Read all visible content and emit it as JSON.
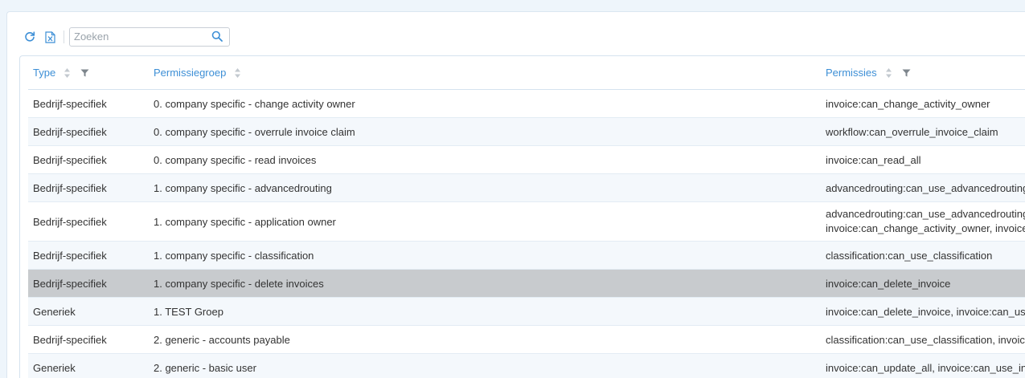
{
  "toolbar": {
    "refresh_icon": "refresh-icon",
    "excel_icon": "excel-export-icon",
    "search_placeholder": "Zoeken",
    "search_value": ""
  },
  "table": {
    "columns": [
      {
        "label": "Type",
        "sortable": true,
        "filterable": true
      },
      {
        "label": "Permissiegroep",
        "sortable": true,
        "filterable": false
      },
      {
        "label": "Permissies",
        "sortable": true,
        "filterable": true
      }
    ],
    "rows": [
      {
        "type": "Bedrijf-specifiek",
        "group": "0. company specific - change activity owner",
        "permissions": [
          "invoice:can_change_activity_owner"
        ]
      },
      {
        "type": "Bedrijf-specifiek",
        "group": "0. company specific - overrule invoice claim",
        "permissions": [
          "workflow:can_overrule_invoice_claim"
        ]
      },
      {
        "type": "Bedrijf-specifiek",
        "group": "0. company specific - read invoices",
        "permissions": [
          "invoice:can_read_all"
        ]
      },
      {
        "type": "Bedrijf-specifiek",
        "group": "1. company specific - advancedrouting",
        "permissions": [
          "advancedrouting:can_use_advancedrouting"
        ]
      },
      {
        "type": "Bedrijf-specifiek",
        "group": "1. company specific - application owner",
        "permissions": [
          "advancedrouting:can_use_advancedrouting,",
          "invoice:can_change_activity_owner, invoice:c"
        ]
      },
      {
        "type": "Bedrijf-specifiek",
        "group": "1. company specific - classification",
        "permissions": [
          "classification:can_use_classification"
        ]
      },
      {
        "type": "Bedrijf-specifiek",
        "group": "1. company specific - delete invoices",
        "permissions": [
          "invoice:can_delete_invoice"
        ],
        "selected": true
      },
      {
        "type": "Generiek",
        "group": "1. TEST Groep",
        "permissions": [
          "invoice:can_delete_invoice, invoice:can_use_"
        ]
      },
      {
        "type": "Bedrijf-specifiek",
        "group": "2. generic - accounts payable",
        "permissions": [
          "classification:can_use_classification, invoice"
        ]
      },
      {
        "type": "Generiek",
        "group": "2. generic - basic user",
        "permissions": [
          "invoice:can_update_all, invoice:can_use_invo"
        ]
      }
    ]
  },
  "colors": {
    "accent": "#3d8fd6",
    "selected_row": "#c8cbce",
    "alt_row": "#f4f8fc",
    "background": "#eef5fb"
  }
}
